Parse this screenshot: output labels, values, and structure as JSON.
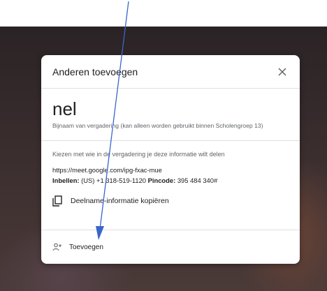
{
  "dialog": {
    "title": "Anderen toevoegen",
    "close_label": "Sluiten",
    "meeting_name": "nel",
    "nickname_hint": "Bijnaam van vergadering (kan alleen worden gebruikt binnen Scholengroep 13)",
    "share_intro": "Kiezen met wie in de vergadering je deze informatie wilt delen",
    "meet_link": "https://meet.google.com/ipg-fxac-mue",
    "dial_in_label": "Inbellen:",
    "dial_in_number": "(US) +1 318-519-1120",
    "pin_label": "Pincode:",
    "pin_value": "395 484 340#",
    "copy_button_label": "Deelname-informatie kopiëren",
    "add_button_label": "Toevoegen"
  },
  "icons": {
    "close": "close-icon",
    "copy": "copy-icon",
    "add_person": "add-person-icon"
  },
  "colors": {
    "annotation_arrow": "#3a66c9",
    "text_primary": "#202124",
    "text_secondary": "#5f6368"
  }
}
